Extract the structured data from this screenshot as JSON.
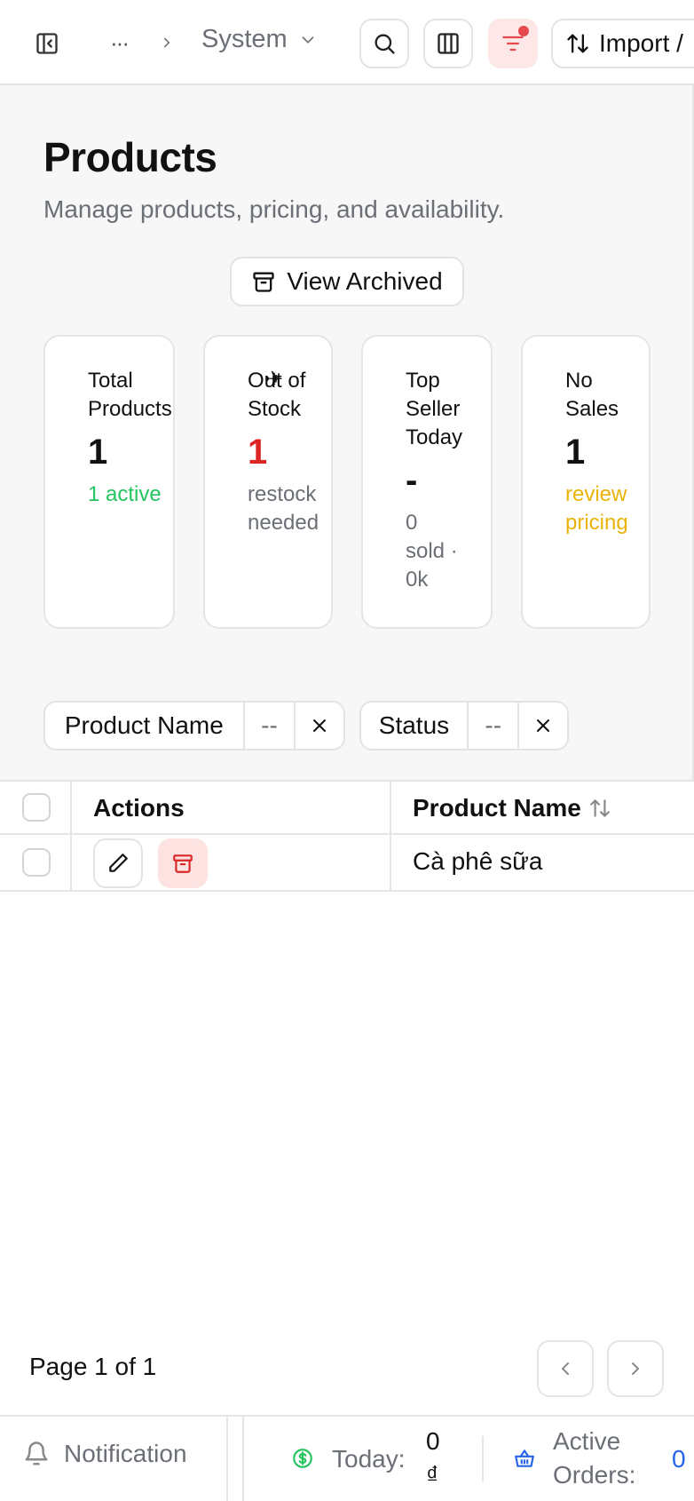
{
  "topbar": {
    "breadcrumb_more": "···",
    "breadcrumb_current": "System",
    "import_label": "Import /"
  },
  "page": {
    "title": "Products",
    "subtitle": "Manage products, pricing, and availability.",
    "view_archived_label": "View Archived"
  },
  "stats": [
    {
      "label": "Total Products",
      "value": "1",
      "note": "1 active",
      "note_color": "#22c55e"
    },
    {
      "label": "Out of Stock",
      "value": "1",
      "note": "restock needed",
      "value_color": "#dc2626",
      "note_color": "#6b6f76"
    },
    {
      "label": "Top Seller Today",
      "value": "-",
      "note": "0 sold · 0k",
      "note_color": "#6b6f76"
    },
    {
      "label": "No Sales",
      "value": "1",
      "note": "review pricing",
      "note_color": "#eab308"
    }
  ],
  "filters": [
    {
      "field": "Product Name",
      "operator": "--"
    },
    {
      "field": "Status",
      "operator": "--"
    }
  ],
  "table": {
    "columns": [
      "Actions",
      "Product Name"
    ],
    "rows": [
      {
        "product_name": "Cà phê sữa"
      }
    ]
  },
  "pagination": {
    "label": "Page 1 of 1"
  },
  "footer": {
    "notification_label": "Notification",
    "today_label": "Today:",
    "today_value_top": "0",
    "today_value_bottom": "₫",
    "active_orders_line1": "Active",
    "active_orders_line2": "Orders:",
    "active_orders_value": "0"
  },
  "colors": {
    "accent_danger": "#e5484d",
    "success": "#22c55e",
    "warning": "#eab308",
    "link_blue": "#2563eb"
  }
}
